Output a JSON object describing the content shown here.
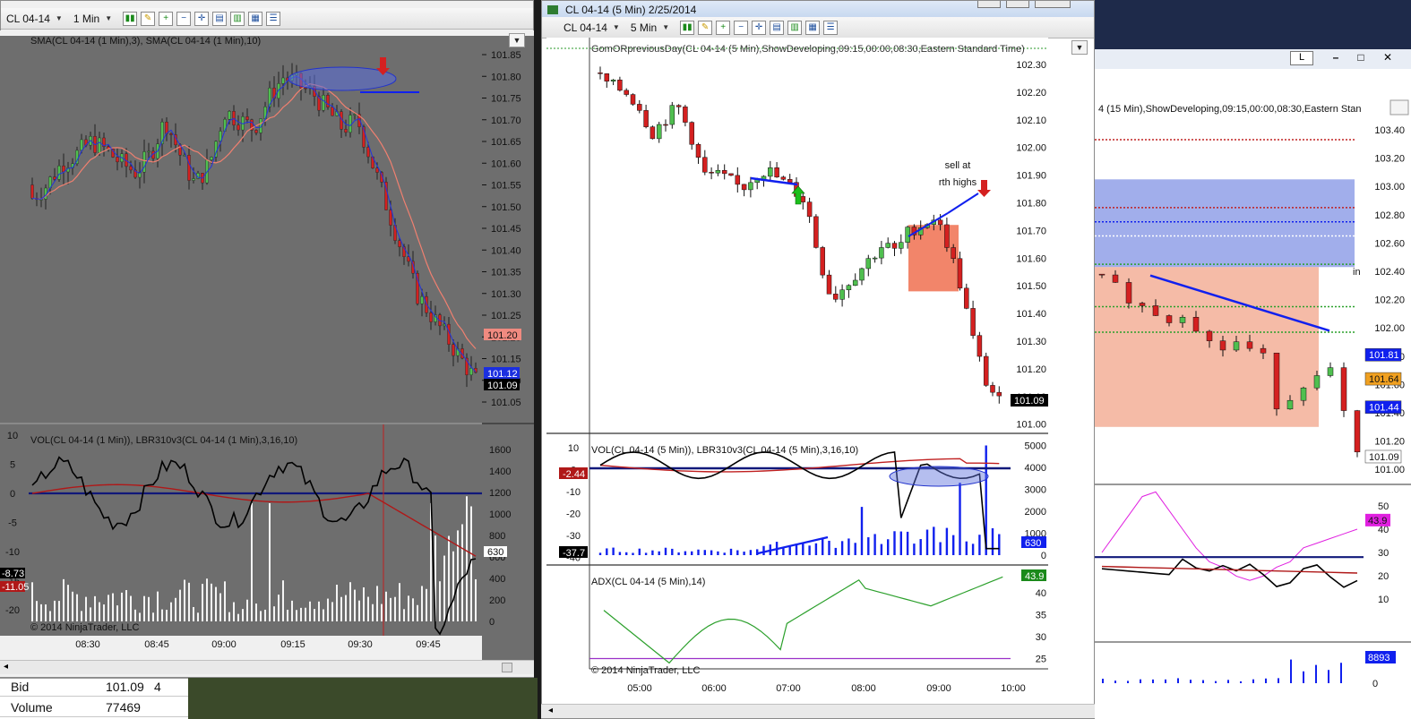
{
  "left_chart": {
    "toolbar": {
      "instrument": "CL 04-14",
      "interval": "1 Min"
    },
    "price_panel": {
      "indicator_label": "SMA(CL 04-14 (1 Min),3), SMA(CL 04-14 (1 Min),10)",
      "y_ticks": [
        "101.85",
        "101.80",
        "101.75",
        "101.70",
        "101.65",
        "101.60",
        "101.55",
        "101.50",
        "101.45",
        "101.40",
        "101.35",
        "101.30",
        "101.25",
        "101.20",
        "101.15",
        "101.10",
        "101.05"
      ],
      "markers": {
        "sma_slow": "101.20",
        "sma_fast": "101.12",
        "last": "101.09"
      }
    },
    "osc_panel": {
      "indicator_label": "VOL(CL 04-14 (1 Min)), LBR310v3(CL 04-14 (1 Min),3,16,10)",
      "left_ticks": [
        "10",
        "5",
        "0",
        "-5",
        "-10",
        "-15",
        "-20"
      ],
      "right_ticks": [
        "1600",
        "1400",
        "1200",
        "1000",
        "800",
        "600",
        "400",
        "200",
        "0"
      ],
      "markers": {
        "fast": "-8.73",
        "slow": "-11.05",
        "volume": "630"
      },
      "copyright": "© 2014 NinjaTrader, LLC"
    },
    "x_ticks": [
      "08:30",
      "08:45",
      "09:00",
      "09:15",
      "09:30",
      "09:45"
    ],
    "colors": {
      "bg": "#6e6e6e",
      "up": "#4fbf4f",
      "down": "#d42020",
      "sma_fast": "#2233dd",
      "sma_slow": "#f08070"
    }
  },
  "middle_chart": {
    "title": "CL 04-14 (5 Min)  2/25/2014",
    "toolbar": {
      "instrument": "CL 04-14",
      "interval": "5 Min"
    },
    "price_panel": {
      "indicator_label": "GomORpreviousDay(CL 04-14 (5 Min),ShowDeveloping,09:15,00:00,08:30,Eastern Standard Time)",
      "y_ticks": [
        "102.30",
        "102.20",
        "102.10",
        "102.00",
        "101.90",
        "101.80",
        "101.70",
        "101.60",
        "101.50",
        "101.40",
        "101.30",
        "101.20",
        "101.10",
        "101.00"
      ],
      "annotation_line1": "sell at",
      "annotation_line2": "rth highs",
      "last_marker": "101.09"
    },
    "osc_panel": {
      "indicator_label": "VOL(CL 04-14 (5 Min)), LBR310v3(CL 04-14 (5 Min),3,16,10)",
      "left_ticks": [
        "10",
        "0",
        "-10",
        "-20",
        "-30",
        "-40"
      ],
      "right_ticks": [
        "5000",
        "4000",
        "3000",
        "2000",
        "1000",
        "0"
      ],
      "markers": {
        "slow": "-2.44",
        "fast": "-37.7",
        "volume": "630"
      }
    },
    "adx_panel": {
      "indicator_label": "ADX(CL 04-14 (5 Min),14)",
      "right_ticks": [
        "40",
        "35",
        "30",
        "25"
      ],
      "marker": "43.9",
      "copyright": "© 2014 NinjaTrader, LLC"
    },
    "x_ticks": [
      "05:00",
      "06:00",
      "07:00",
      "08:00",
      "09:00",
      "10:00"
    ],
    "colors": {
      "up": "#4fbf4f",
      "down": "#d42020",
      "zone": "#f07050",
      "adx": "#2ca02c",
      "osc_fast": "#000000",
      "osc_slow": "#c02020"
    }
  },
  "right_chart": {
    "price_panel": {
      "indicator_label": "4 (15 Min),ShowDeveloping,09:15,00:00,08:30,Eastern Stan",
      "y_ticks": [
        "103.40",
        "103.20",
        "103.00",
        "102.80",
        "102.60",
        "102.40",
        "102.20",
        "102.00",
        "101.80",
        "101.60",
        "101.40",
        "101.20",
        "101.00"
      ],
      "markers": {
        "m1": "101.81",
        "m2": "101.64",
        "m3": "101.44",
        "m4": "101.09"
      },
      "fragment_text": "in"
    },
    "osc_panel": {
      "right_ticks": [
        "50",
        "40",
        "30",
        "20",
        "10"
      ],
      "marker": "43.9"
    },
    "vol_panel": {
      "marker": "8893",
      "right_ticks": [
        "0"
      ]
    },
    "window_buttons": {
      "minimize": "–",
      "maximize": "□",
      "close": "✕",
      "tab": "L"
    }
  },
  "quote_table": {
    "rows": [
      {
        "label": "Bid",
        "value": "101.09",
        "qty": "4"
      },
      {
        "label": "Volume",
        "value": "77469",
        "qty": ""
      }
    ]
  }
}
